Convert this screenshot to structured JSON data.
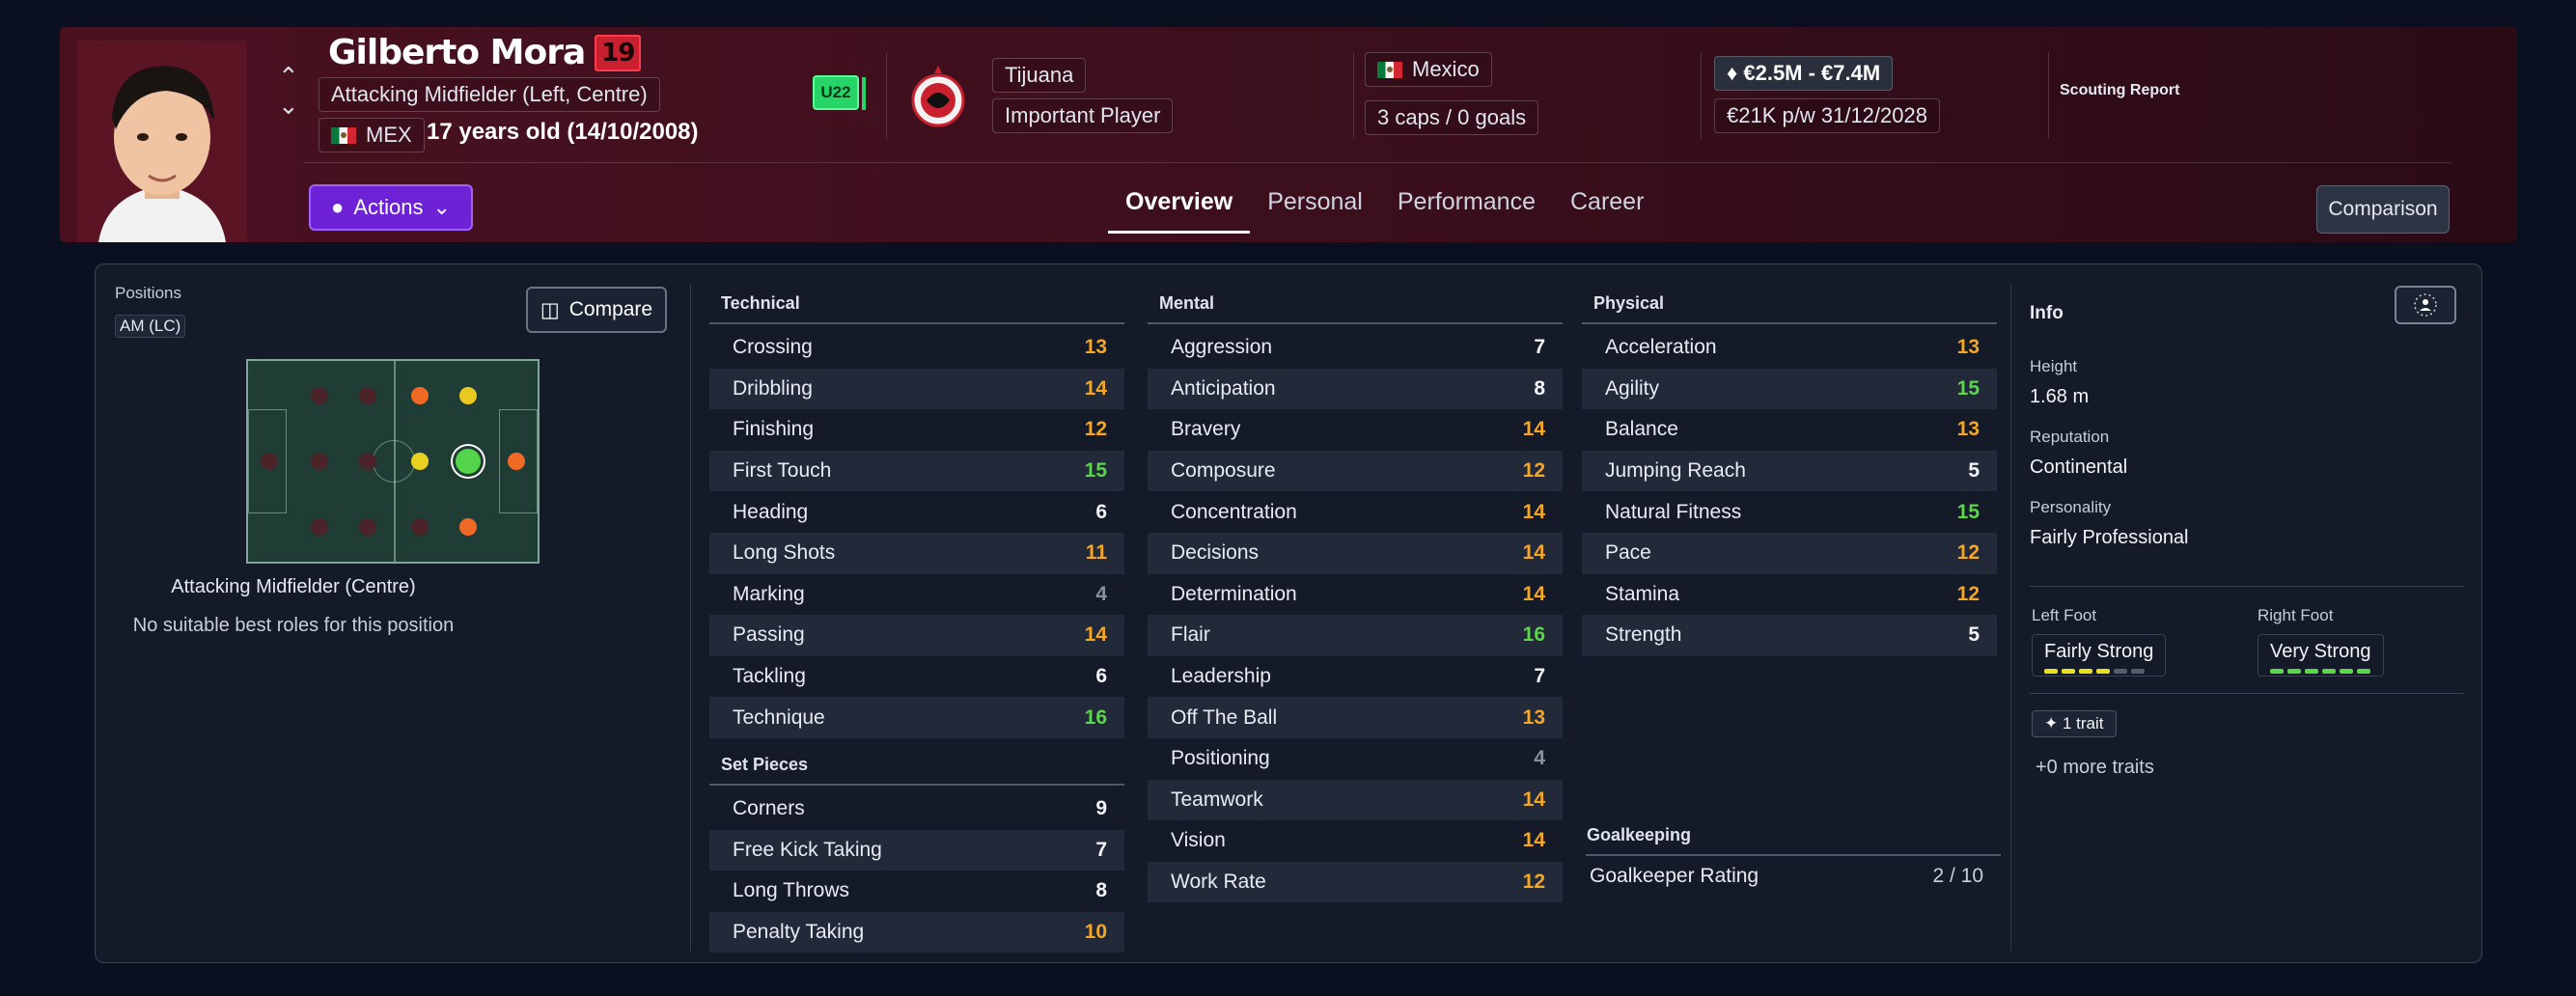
{
  "player": {
    "name": "Gilberto Mora",
    "age_badge": "19",
    "position_desc": "Attacking Midfielder (Left, Centre)",
    "nation_code": "MEX",
    "age_text": "17 years old (14/10/2008)",
    "u22": "U22"
  },
  "club": {
    "name": "Tijuana",
    "status": "Important Player"
  },
  "nation": {
    "name": "Mexico",
    "caps": "3 caps / 0 goals"
  },
  "value": {
    "range": "€2.5M - €7.4M",
    "wage": "€21K p/w",
    "contract": "31/12/2028"
  },
  "scouting_report": "Scouting Report",
  "actions_label": "Actions",
  "tabs": [
    "Overview",
    "Personal",
    "Performance",
    "Career"
  ],
  "comparison_label": "Comparison",
  "positions": {
    "label": "Positions",
    "tag": "AM (LC)",
    "compare_label": "Compare",
    "position_name": "Attacking Midfielder (Centre)",
    "note": "No suitable best roles for this position"
  },
  "technical": {
    "title": "Technical",
    "items": [
      {
        "name": "Crossing",
        "value": "13",
        "color": "orange"
      },
      {
        "name": "Dribbling",
        "value": "14",
        "color": "orange"
      },
      {
        "name": "Finishing",
        "value": "12",
        "color": "orange"
      },
      {
        "name": "First Touch",
        "value": "15",
        "color": "green"
      },
      {
        "name": "Heading",
        "value": "6",
        "color": "white"
      },
      {
        "name": "Long Shots",
        "value": "11",
        "color": "orange"
      },
      {
        "name": "Marking",
        "value": "4",
        "color": "gray"
      },
      {
        "name": "Passing",
        "value": "14",
        "color": "orange"
      },
      {
        "name": "Tackling",
        "value": "6",
        "color": "white"
      },
      {
        "name": "Technique",
        "value": "16",
        "color": "green"
      }
    ]
  },
  "set_pieces": {
    "title": "Set Pieces",
    "items": [
      {
        "name": "Corners",
        "value": "9",
        "color": "white"
      },
      {
        "name": "Free Kick Taking",
        "value": "7",
        "color": "white"
      },
      {
        "name": "Long Throws",
        "value": "8",
        "color": "white"
      },
      {
        "name": "Penalty Taking",
        "value": "10",
        "color": "orange"
      }
    ]
  },
  "mental": {
    "title": "Mental",
    "items": [
      {
        "name": "Aggression",
        "value": "7",
        "color": "white"
      },
      {
        "name": "Anticipation",
        "value": "8",
        "color": "white"
      },
      {
        "name": "Bravery",
        "value": "14",
        "color": "orange"
      },
      {
        "name": "Composure",
        "value": "12",
        "color": "orange"
      },
      {
        "name": "Concentration",
        "value": "14",
        "color": "orange"
      },
      {
        "name": "Decisions",
        "value": "14",
        "color": "orange"
      },
      {
        "name": "Determination",
        "value": "14",
        "color": "orange"
      },
      {
        "name": "Flair",
        "value": "16",
        "color": "green"
      },
      {
        "name": "Leadership",
        "value": "7",
        "color": "white"
      },
      {
        "name": "Off The Ball",
        "value": "13",
        "color": "orange"
      },
      {
        "name": "Positioning",
        "value": "4",
        "color": "gray"
      },
      {
        "name": "Teamwork",
        "value": "14",
        "color": "orange"
      },
      {
        "name": "Vision",
        "value": "14",
        "color": "orange"
      },
      {
        "name": "Work Rate",
        "value": "12",
        "color": "orange"
      }
    ]
  },
  "physical": {
    "title": "Physical",
    "items": [
      {
        "name": "Acceleration",
        "value": "13",
        "color": "orange"
      },
      {
        "name": "Agility",
        "value": "15",
        "color": "green"
      },
      {
        "name": "Balance",
        "value": "13",
        "color": "orange"
      },
      {
        "name": "Jumping Reach",
        "value": "5",
        "color": "white"
      },
      {
        "name": "Natural Fitness",
        "value": "15",
        "color": "green"
      },
      {
        "name": "Pace",
        "value": "12",
        "color": "orange"
      },
      {
        "name": "Stamina",
        "value": "12",
        "color": "orange"
      },
      {
        "name": "Strength",
        "value": "5",
        "color": "white"
      }
    ]
  },
  "goalkeeping": {
    "title": "Goalkeeping",
    "label": "Goalkeeper Rating",
    "value": "2 / 10"
  },
  "info": {
    "title": "Info",
    "height_label": "Height",
    "height": "1.68 m",
    "reputation_label": "Reputation",
    "reputation": "Continental",
    "personality_label": "Personality",
    "personality": "Fairly Professional",
    "left_foot_label": "Left Foot",
    "left_foot": "Fairly Strong",
    "left_foot_level": 4,
    "right_foot_label": "Right Foot",
    "right_foot": "Very Strong",
    "right_foot_level": 6,
    "trait_label": "1 trait",
    "more_traits": "+0 more traits"
  },
  "colors": {
    "orange": "#f5a623",
    "green": "#5bd649",
    "white": "#f2f4f8",
    "gray": "#8a909e",
    "accent": "#6e22d6"
  }
}
